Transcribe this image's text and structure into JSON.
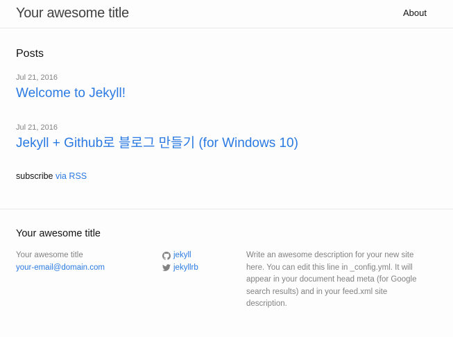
{
  "header": {
    "site_title": "Your awesome title",
    "nav": [
      {
        "label": "About"
      }
    ]
  },
  "main": {
    "heading": "Posts",
    "posts": [
      {
        "date": "Jul 21, 2016",
        "title": "Welcome to Jekyll!"
      },
      {
        "date": "Jul 21, 2016",
        "title": "Jekyll + Github로 블로그 만들기 (for Windows 10)"
      }
    ],
    "subscribe_text": "subscribe",
    "subscribe_link": "via RSS"
  },
  "footer": {
    "heading": "Your awesome title",
    "contact_name": "Your awesome title",
    "email": "your-email@domain.com",
    "social": [
      {
        "icon": "github-icon",
        "label": "jekyll"
      },
      {
        "icon": "twitter-icon",
        "label": "jekyllrb"
      }
    ],
    "description": "Write an awesome description for your new site here. You can edit this line in _config.yml. It will appear in your document head meta (for Google search results) and in your feed.xml site description."
  },
  "colors": {
    "link": "#2a7ae2",
    "meta": "#828282",
    "border": "#e8e8e8",
    "background": "#fdfdfd"
  }
}
